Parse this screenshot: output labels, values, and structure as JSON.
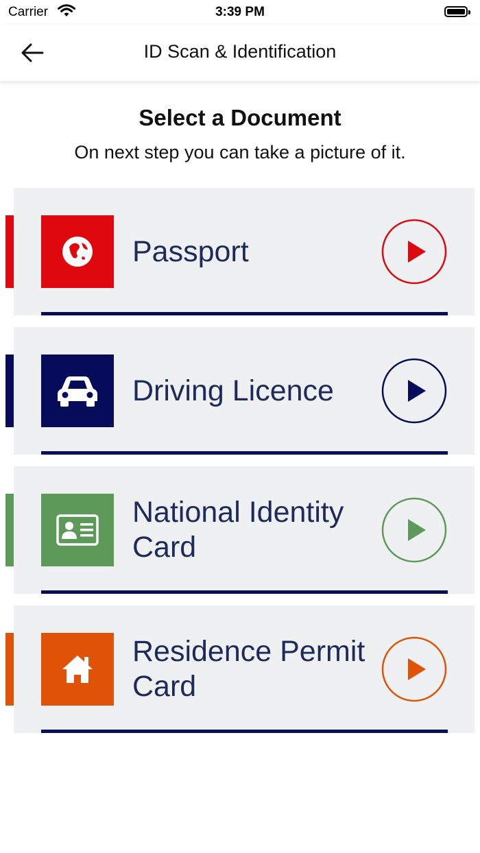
{
  "status_bar": {
    "carrier": "Carrier",
    "time": "3:39 PM"
  },
  "nav": {
    "title": "ID Scan & Identification",
    "back_icon": "arrow-left-icon"
  },
  "page": {
    "heading": "Select a Document",
    "subheading": "On next step you can take a picture of it."
  },
  "documents": [
    {
      "label": "Passport",
      "icon": "globe-icon",
      "color": "#e0080f"
    },
    {
      "label": "Driving Licence",
      "icon": "car-icon",
      "color": "#060b5a"
    },
    {
      "label": "National Identity Card",
      "icon": "id-card-icon",
      "color": "#5d9a59"
    },
    {
      "label": "Residence Permit Card",
      "icon": "home-icon",
      "color": "#e05306"
    }
  ],
  "colors": {
    "underline": "#0a0f55",
    "card_background": "#eff0f2",
    "label_text": "#1d2a5c"
  }
}
